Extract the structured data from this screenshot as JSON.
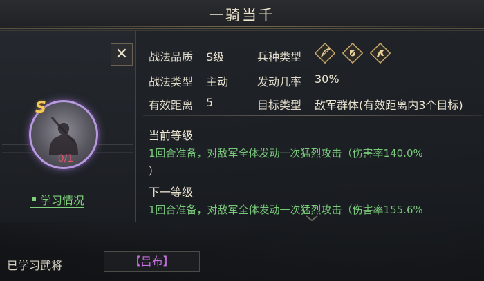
{
  "title": "一骑当千",
  "stats": {
    "quality_label": "战法品质",
    "quality_value": "S级",
    "type_label": "战法类型",
    "type_value": "主动",
    "range_label": "有效距离",
    "range_value": "5",
    "troop_label": "兵种类型",
    "troop_icons": [
      "bow-icon",
      "shield-icon",
      "horse-icon"
    ],
    "rate_label": "发动几率",
    "rate_value": "30%",
    "target_label": "目标类型",
    "target_value": "敌军群体(有效距离内3个目标)"
  },
  "portrait": {
    "grade": "S",
    "progress": "0/1"
  },
  "learn_link": "学习情况",
  "current_level": {
    "heading": "当前等级",
    "desc_prefix": "1回合准备，对敌军全体发动一次猛烈攻击（伤害率",
    "desc_value": "140.0%",
    "desc_suffix": "）"
  },
  "next_level": {
    "heading": "下一等级",
    "desc_prefix": "1回合准备，对敌军全体发动一次猛烈攻击（伤害率",
    "desc_value": "155.6%"
  },
  "learned": {
    "label": "已学习武将",
    "general": "【吕布】"
  },
  "colors": {
    "accent_green": "#79c97b",
    "purple_name": "#c66fe0",
    "grade_gold": "#f2c95a",
    "progress_red": "#e2566a"
  }
}
